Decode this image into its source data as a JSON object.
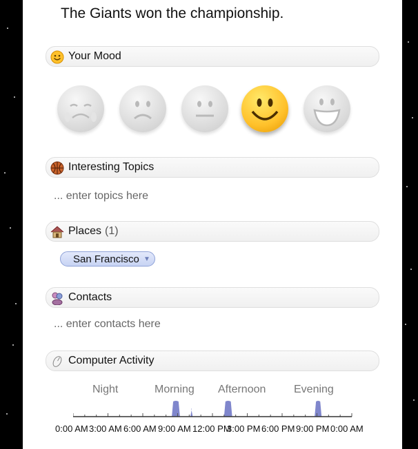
{
  "headline": "The Giants won the championship.",
  "mood": {
    "title": "Your Mood",
    "options": [
      "very-sad-icon",
      "sad-icon",
      "neutral-icon",
      "happy-icon",
      "very-happy-icon"
    ],
    "selected_index": 3,
    "colors": {
      "selected": "#ffc12b",
      "unselected": "#d8d8d8"
    }
  },
  "topics": {
    "title": "Interesting Topics",
    "placeholder": "... enter topics here"
  },
  "places": {
    "title": "Places",
    "count": "(1)",
    "items": [
      "San Francisco"
    ]
  },
  "contacts": {
    "title": "Contacts",
    "placeholder": "... enter contacts here"
  },
  "activity": {
    "title": "Computer Activity",
    "periods": [
      "Night",
      "Morning",
      "Afternoon",
      "Evening"
    ],
    "time_labels": [
      "0:00 AM",
      "3:00 AM",
      "6:00 AM",
      "9:00 AM",
      "12:00 PM",
      "3:00 PM",
      "6:00 PM",
      "9:00 PM",
      "0:00 AM"
    ],
    "fill_color": "#7f86cc",
    "chart_data": {
      "type": "area",
      "x_range_hours": [
        0,
        24
      ],
      "bursts_hours": [
        {
          "start": 8.5,
          "end": 9.2,
          "level": 1.0
        },
        {
          "start": 10.1,
          "end": 10.3,
          "level": 0.5
        },
        {
          "start": 13.0,
          "end": 13.7,
          "level": 1.0
        },
        {
          "start": 20.8,
          "end": 21.4,
          "level": 1.0
        }
      ]
    }
  }
}
